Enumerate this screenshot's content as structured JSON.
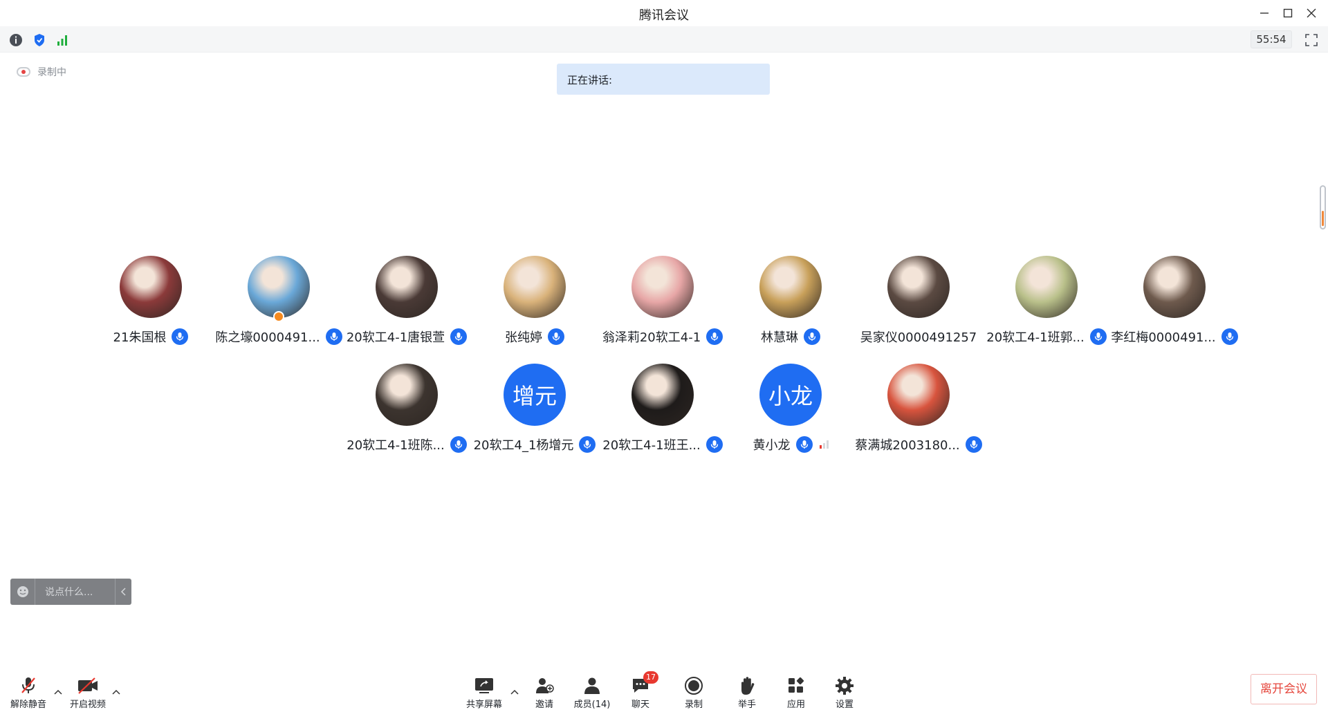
{
  "window": {
    "title": "腾讯会议"
  },
  "topbar": {
    "timer": "55:54"
  },
  "recording": {
    "label": "录制中"
  },
  "speaking": {
    "label": "正在讲话:"
  },
  "participants": [
    {
      "name": "21朱国根",
      "mic": "on",
      "avatar_color": "#8b3a3a",
      "initials": ""
    },
    {
      "name": "陈之壕0000491...",
      "mic": "speaking",
      "avatar_color": "#6aa8d8",
      "initials": "",
      "host": true
    },
    {
      "name": "20软工4-1唐银萱",
      "mic": "on",
      "avatar_color": "#4a3a36",
      "initials": ""
    },
    {
      "name": "张纯婷",
      "mic": "on",
      "avatar_color": "#d9b27a",
      "initials": ""
    },
    {
      "name": "翁泽莉20软工4-1",
      "mic": "on",
      "avatar_color": "#e7a6a6",
      "initials": ""
    },
    {
      "name": "林慧琳",
      "mic": "on",
      "avatar_color": "#c8a05a",
      "initials": ""
    },
    {
      "name": "吴家仪0000491257",
      "mic": "none",
      "avatar_color": "#5b4a42",
      "initials": ""
    },
    {
      "name": "20软工4-1班郭...",
      "mic": "on",
      "avatar_color": "#b9c08a",
      "initials": ""
    },
    {
      "name": "李红梅0000491...",
      "mic": "on",
      "avatar_color": "#6e5a4d",
      "initials": ""
    },
    {
      "name": "20软工4-1班陈...",
      "mic": "on",
      "avatar_color": "#3c342f",
      "initials": ""
    },
    {
      "name": "20软工4_1杨增元",
      "mic": "on",
      "avatar_color": "#1f6df2",
      "initials": "增元"
    },
    {
      "name": "20软工4-1班王...",
      "mic": "on",
      "avatar_color": "#1e1b1a",
      "initials": ""
    },
    {
      "name": "黄小龙",
      "mic": "on",
      "avatar_color": "#1f6df2",
      "initials": "小龙",
      "signal": true
    },
    {
      "name": "蔡满城2003180...",
      "mic": "on",
      "avatar_color": "#d8543e",
      "initials": ""
    }
  ],
  "chat": {
    "placeholder": "说点什么..."
  },
  "toolbar": {
    "unmute": "解除静音",
    "video": "开启视频",
    "share": "共享屏幕",
    "invite": "邀请",
    "members": "成员(14)",
    "chat": "聊天",
    "chat_badge": "17",
    "record": "录制",
    "raise_hand": "举手",
    "apps": "应用",
    "settings": "设置",
    "leave": "离开会议"
  }
}
